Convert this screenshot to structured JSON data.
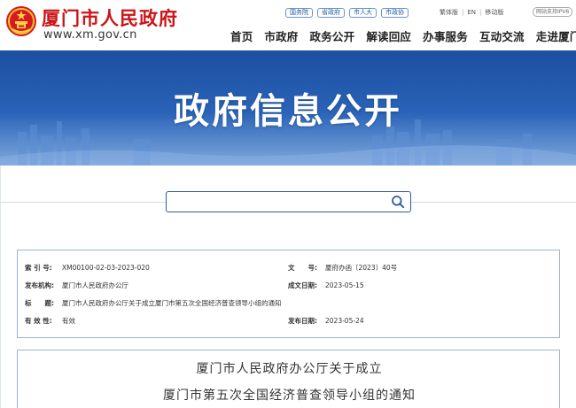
{
  "header": {
    "site_name": "厦门市人民政府",
    "site_url": "www.xm.gov.cn",
    "top_links": [
      "国务院",
      "省政府",
      "市人大",
      "市政协"
    ],
    "util_links": [
      "繁体版",
      "EN",
      "移动版"
    ],
    "ipv6_badge": "网站支持IPV6",
    "nav": [
      "首页",
      "市政府",
      "政务公开",
      "解读回应",
      "办事服务",
      "互动交流",
      "走进厦门"
    ]
  },
  "banner": {
    "title": "政府信息公开"
  },
  "search": {
    "value": "",
    "placeholder": ""
  },
  "meta": {
    "index_label": "索 引 号:",
    "index_value": "XM00100-02-03-2023-020",
    "docno_label": "文　　号:",
    "docno_value": "厦府办函〔2023〕40号",
    "issuer_label": "发布机构:",
    "issuer_value": "厦门市人民政府办公厅",
    "date_label": "成文日期:",
    "date_value": "2023-05-15",
    "title_label": "标　　题:",
    "title_value": "厦门市人民政府办公厅关于成立厦门市第五次全国经济普查领导小组的通知",
    "validity_label": "有 效 性:",
    "validity_value": "有效",
    "pubdate_label": "发布日期:",
    "pubdate_value": "2023-05-24"
  },
  "document": {
    "title_line1": "厦门市人民政府办公厅关于成立",
    "title_line2": "厦门市第五次全国经济普查领导小组的通知"
  },
  "colors": {
    "brand_red": "#cc1417",
    "banner_blue": "#2a63b8",
    "link_blue": "#1f5aa8",
    "border_blue": "#9ab3d3"
  }
}
